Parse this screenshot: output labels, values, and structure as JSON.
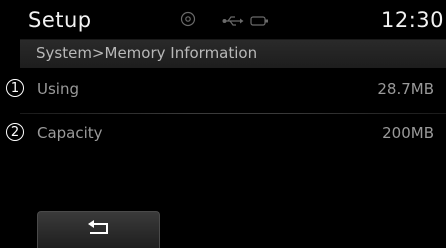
{
  "header": {
    "title": "Setup",
    "clock": "12:30",
    "status_icons": [
      "disc-icon",
      "usb-icon",
      "battery-icon"
    ]
  },
  "breadcrumb": "System>Memory Information",
  "rows": [
    {
      "number": "1",
      "label": "Using",
      "value": "28.7MB"
    },
    {
      "number": "2",
      "label": "Capacity",
      "value": "200MB"
    }
  ],
  "footer": {
    "back_icon": "back-arrow-icon"
  }
}
